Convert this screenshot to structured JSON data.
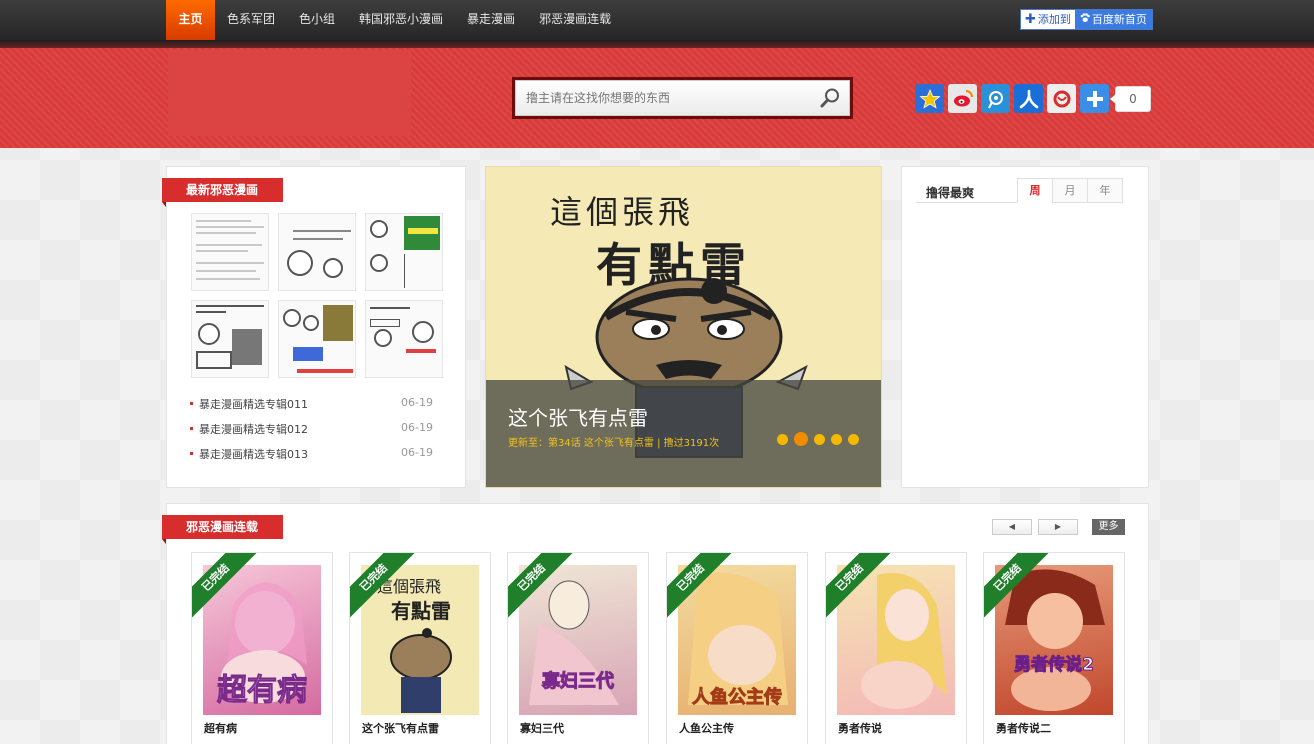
{
  "nav": {
    "items": [
      "主页",
      "色系军团",
      "色小组",
      "韩国邪恶小漫画",
      "暴走漫画",
      "邪恶漫画连载"
    ],
    "add_label": "添加到",
    "baidu_label": "百度新首页"
  },
  "search": {
    "placeholder": "撸主请在这找你想要的东西"
  },
  "share": {
    "count": "0"
  },
  "latest": {
    "title": "最新邪恶漫画",
    "list": [
      {
        "title": "暴走漫画精选专辑011",
        "date": "06-19"
      },
      {
        "title": "暴走漫画精选专辑012",
        "date": "06-19"
      },
      {
        "title": "暴走漫画精选专辑013",
        "date": "06-19"
      }
    ]
  },
  "slider": {
    "art_line1": "這個張飛",
    "art_line2": "有點雷",
    "title": "这个张飞有点雷",
    "subtitle": "更新至：第34话 这个张飞有点雷 | 撸过3191次"
  },
  "rank": {
    "title": "撸得最爽",
    "tabs": [
      "周",
      "月",
      "年"
    ]
  },
  "serial": {
    "title": "邪恶漫画连载",
    "more_label": "更多",
    "badge": "已完结",
    "cards": [
      {
        "title": "超有病",
        "cover_text": "超有病",
        "color_a": "#f6c7d8",
        "color_b": "#d56aa0"
      },
      {
        "title": "这个张飞有点雷",
        "cover_text": "",
        "color_a": "#f3e9b5",
        "color_b": "#e6d58d"
      },
      {
        "title": "寡妇三代",
        "cover_text": "寡妇三代",
        "color_a": "#efe6d6",
        "color_b": "#d7a3b4"
      },
      {
        "title": "人鱼公主传",
        "cover_text": "人鱼公主传",
        "color_a": "#f3dba0",
        "color_b": "#e7b070"
      },
      {
        "title": "勇者传说",
        "cover_text": "",
        "color_a": "#f6e3b3",
        "color_b": "#f3b9b6"
      },
      {
        "title": "勇者传说二",
        "cover_text": "勇者传说2",
        "color_a": "#e79a7a",
        "color_b": "#c1472c"
      }
    ],
    "card2_line1": "這個張飛",
    "card2_line2": "有點雷"
  },
  "colors": {
    "accent": "#d72d2d",
    "band": "#d93a3a",
    "done": "#1f7f2a",
    "dot": "#f5b800"
  }
}
